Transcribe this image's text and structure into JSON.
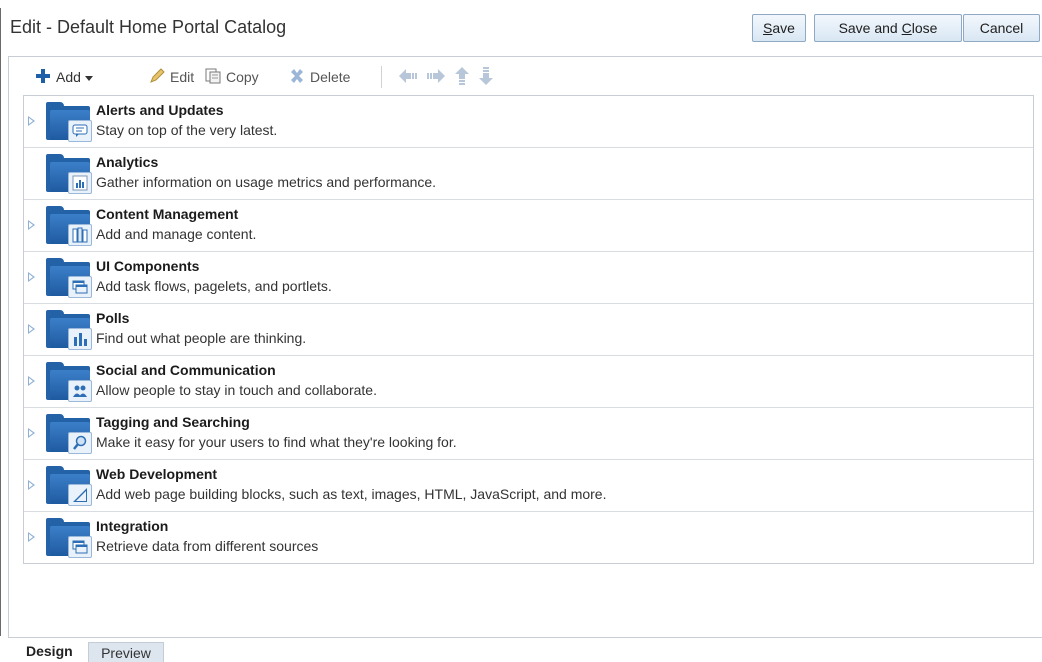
{
  "header": {
    "title": "Edit - Default Home Portal Catalog",
    "save_prefix": "",
    "save_mnemonic": "S",
    "save_rest": "ave",
    "saveclose_prefix": "Save and ",
    "saveclose_mnemonic": "C",
    "saveclose_rest": "lose",
    "cancel_label": "Cancel"
  },
  "toolbar": {
    "add_label": "Add",
    "edit_label": "Edit",
    "copy_label": "Copy",
    "delete_label": "Delete"
  },
  "catalog": {
    "items": [
      {
        "title": "Alerts and Updates",
        "desc": "Stay on top of the very latest.",
        "expandable": true,
        "icon": "chat-bubble-icon"
      },
      {
        "title": "Analytics",
        "desc": "Gather information on usage metrics and performance.",
        "expandable": false,
        "icon": "report-icon"
      },
      {
        "title": "Content Management",
        "desc": "Add and manage content.",
        "expandable": true,
        "icon": "documents-icon"
      },
      {
        "title": "UI Components",
        "desc": "Add task flows, pagelets, and portlets.",
        "expandable": true,
        "icon": "windows-icon"
      },
      {
        "title": "Polls",
        "desc": "Find out what people are thinking.",
        "expandable": true,
        "icon": "bar-chart-icon"
      },
      {
        "title": "Social and Communication",
        "desc": "Allow people to stay in touch and collaborate.",
        "expandable": true,
        "icon": "people-icon"
      },
      {
        "title": "Tagging and Searching",
        "desc": "Make it easy for your users to find what they're looking for.",
        "expandable": true,
        "icon": "magnifier-icon"
      },
      {
        "title": "Web Development",
        "desc": "Add web page building blocks, such as text, images, HTML, JavaScript, and more.",
        "expandable": true,
        "icon": "pen-icon"
      },
      {
        "title": "Integration",
        "desc": "Retrieve data from different sources",
        "expandable": true,
        "icon": "windows-icon"
      }
    ]
  },
  "tabs": {
    "design_label": "Design",
    "preview_label": "Preview"
  },
  "colors": {
    "folder_blue": "#2462a8",
    "accent_green_add": "#1f6fb5"
  }
}
